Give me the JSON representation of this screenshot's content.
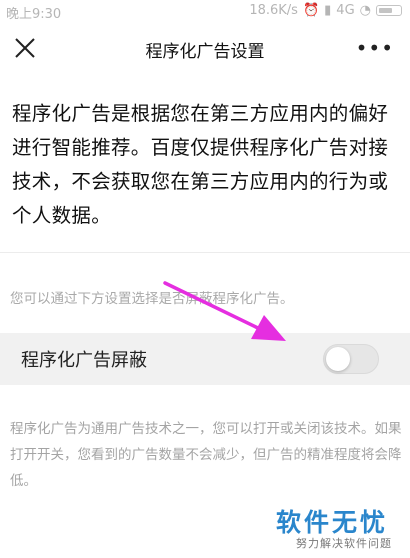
{
  "status_bar": {
    "time": "晚上9:30",
    "speed": "18.6K/s",
    "network": "4G"
  },
  "navbar": {
    "title": "程序化广告设置",
    "close_icon": "close-icon",
    "more_icon": "more-icon"
  },
  "intro_text": "程序化广告是根据您在第三方应用内的偏好进行智能推荐。百度仅提供程序化广告对接技术，不会获取您在第三方应用内的行为或个人数据。",
  "hint_text": "您可以通过下方设置选择是否屏蔽程序化广告。",
  "setting": {
    "label": "程序化广告屏蔽",
    "enabled": false
  },
  "description": "程序化广告为通用广告技术之一，您可以打开或关闭该技术。如果打开开关，您看到的广告数量不会减少，但广告的精准程度将会降低。",
  "watermark": {
    "title": "软件无忧",
    "subtitle": "努力解决软件问题"
  },
  "colors": {
    "arrow": "#e52ee0",
    "watermark": "#2a86cc",
    "row_background": "#f1f1f1"
  }
}
